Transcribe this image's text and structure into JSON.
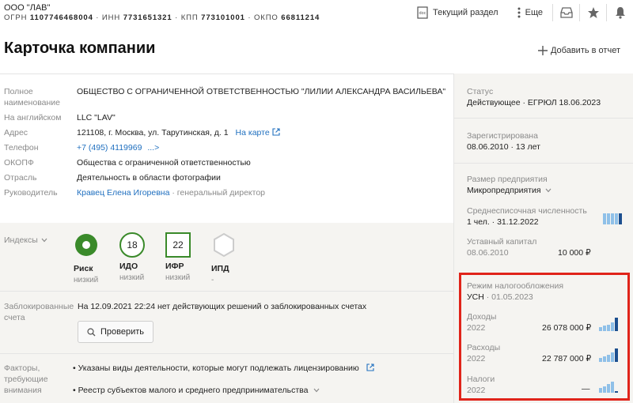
{
  "header": {
    "company_short": "ООО \"ЛАВ\"",
    "ogrn_label": "ОГРН",
    "ogrn": "1107746468004",
    "inn_label": "ИНН",
    "inn": "7731651321",
    "kpp_label": "КПП",
    "kpp": "773101001",
    "okpo_label": "ОКПО",
    "okpo": "66811214",
    "current_section": "Текущий раздел",
    "more": "Еще",
    "page_title": "Карточка компании",
    "add_to_report": "Добавить в отчет"
  },
  "info": {
    "full_name_label_1": "Полное",
    "full_name_label_2": "наименование",
    "full_name": "ОБЩЕСТВО С ОГРАНИЧЕННОЙ ОТВЕТСТВЕННОСТЬЮ \"ЛИЛИИ АЛЕКСАНДРА ВАСИЛЬЕВА\"",
    "english_label": "На английском",
    "english": "LLC \"LAV\"",
    "address_label": "Адрес",
    "address": "121108, г. Москва, ул. Тарутинская, д. 1",
    "map_link": "На карте",
    "phone_label": "Телефон",
    "phone": "+7 (495) 4119969",
    "phone_more": "...>",
    "okopf_label": "ОКОПФ",
    "okopf": "Общества с ограниченной ответственностью",
    "industry_label": "Отрасль",
    "industry": "Деятельность в области фотографии",
    "head_label": "Руководитель",
    "head_name": "Кравец Елена Игоревна",
    "head_role": "· генеральный директор"
  },
  "indices": {
    "label": "Индексы",
    "items": [
      {
        "name": "Риск",
        "sub": "низкий",
        "badge": ""
      },
      {
        "name": "ИДО",
        "sub": "низкий",
        "badge": "18"
      },
      {
        "name": "ИФР",
        "sub": "низкий",
        "badge": "22"
      },
      {
        "name": "ИПД",
        "sub": "-",
        "badge": ""
      }
    ],
    "colors": {
      "green": "#3a8a2a",
      "grey": "#cccccc"
    }
  },
  "blocked": {
    "label_1": "Заблокированные",
    "label_2": "счета",
    "text": "На 12.09.2021 22:24 нет действующих решений о заблокированных счетах",
    "check_button": "Проверить"
  },
  "factors": {
    "label_1": "Факторы,",
    "label_2": "требующие",
    "label_3": "внимания",
    "item_1": "Указаны виды деятельности, которые могут подлежать лицензированию",
    "item_2": "Реестр субъектов малого и среднего предпринимательства"
  },
  "right": {
    "status_label": "Статус",
    "status_value": "Действующее · ЕГРЮЛ 18.06.2023",
    "registered_label": "Зарегистрирована",
    "registered_value": "08.06.2010 · 13 лет",
    "size_label": "Размер предприятия",
    "size_value": "Микропредприятия",
    "headcount_label": "Среднесписочная численность",
    "headcount_value": "1 чел. · 31.12.2022",
    "capital_label": "Уставный капитал",
    "capital_date": "08.06.2010",
    "capital_value": "10 000 ₽",
    "tax_label": "Режим налогообложения",
    "tax_value": "УСН",
    "tax_date": "· 01.05.2023",
    "income_label": "Доходы",
    "income_year": "2022",
    "income_value": "26 078 000 ₽",
    "expense_label": "Расходы",
    "expense_year": "2022",
    "expense_value": "22 787 000 ₽",
    "taxes_label": "Налоги",
    "taxes_year": "2022",
    "taxes_value": "—"
  },
  "colors": {
    "accent_blue": "#1f6fbf",
    "dark_bar": "#1c4f8f",
    "light_bar": "#8fc0e8",
    "highlight_red": "#e0241a",
    "panel_bg": "#f5f4f1"
  }
}
